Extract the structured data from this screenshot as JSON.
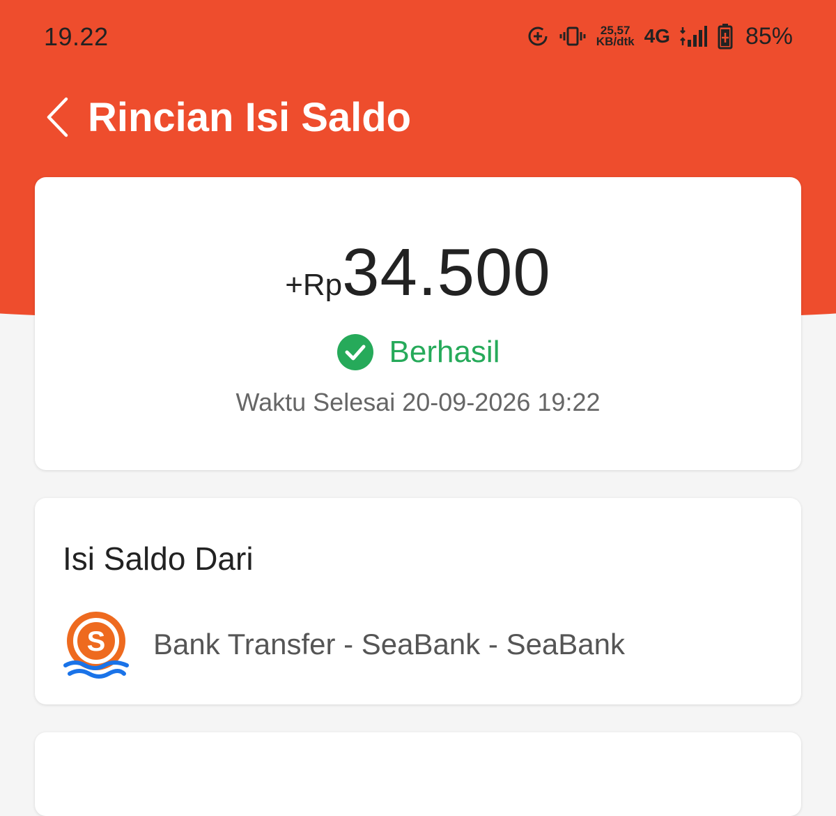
{
  "status_bar": {
    "time": "19.22",
    "net_speed_value": "25,57",
    "net_speed_unit": "KB/dtk",
    "network_type": "4G",
    "battery_percent": "85%"
  },
  "header": {
    "title": "Rincian Isi Saldo"
  },
  "summary": {
    "amount_prefix": "+Rp",
    "amount_value": "34.500",
    "status": "Berhasil",
    "completion_time": "Waktu Selesai 20-09-2026 19:22"
  },
  "source": {
    "title": "Isi Saldo Dari",
    "logo_letter": "S",
    "method": "Bank Transfer - SeaBank - SeaBank"
  },
  "colors": {
    "header": "#ee4d2d",
    "success": "#26aa5a",
    "seabank_orange": "#ee6a1f",
    "seabank_wave": "#1a73e8"
  }
}
